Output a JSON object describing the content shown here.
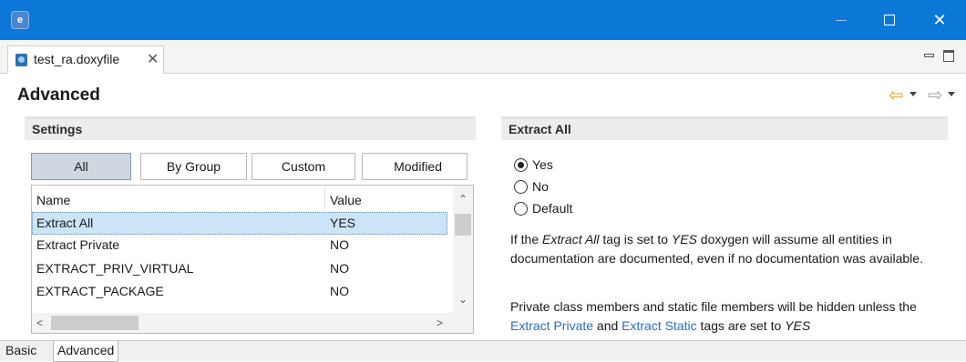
{
  "window": {
    "app_icon_text": "e",
    "minimize_glyph": "—",
    "maximize_glyph": "☐",
    "close_glyph": "✕"
  },
  "editor_tab": {
    "label": "test_ra.doxyfile",
    "close_glyph": "✕"
  },
  "page": {
    "title": "Advanced",
    "back_glyph": "⇦",
    "forward_glyph": "⇨"
  },
  "settings": {
    "header": "Settings",
    "filters": [
      "All",
      "By Group",
      "Custom",
      "Modified"
    ],
    "active_filter": "All",
    "columns": [
      "Name",
      "Value"
    ],
    "rows": [
      {
        "name": "Extract All",
        "value": "YES",
        "selected": true
      },
      {
        "name": "Extract Private",
        "value": "NO",
        "selected": false
      },
      {
        "name": "EXTRACT_PRIV_VIRTUAL",
        "value": "NO",
        "selected": false
      },
      {
        "name": "EXTRACT_PACKAGE",
        "value": "NO",
        "selected": false
      }
    ],
    "scroll_up": "⌃",
    "scroll_down": "⌄",
    "scroll_left": "<",
    "scroll_right": ">"
  },
  "detail": {
    "header": "Extract All",
    "options": [
      "Yes",
      "No",
      "Default"
    ],
    "selected_option": "Yes",
    "para1": {
      "t1": "If the ",
      "em1": "Extract All",
      "t2": " tag is set to ",
      "em2": "YES",
      "t3": " doxygen will assume all entities in documentation are documented, even if no documentation was available."
    },
    "para2": {
      "t1": "Private class members and static file members will be hidden unless the ",
      "link1": "Extract Private",
      "t2": " and ",
      "link2": "Extract Static",
      "t3": " tags are set to ",
      "em1": "YES"
    }
  },
  "bottom_tabs": [
    "Basic",
    "Advanced"
  ],
  "active_bottom_tab": "Advanced",
  "colors": {
    "titlebar": "#0b78d7",
    "selection": "#cce4f7",
    "link": "#2a6fbe",
    "back_arrow": "#f1a21a"
  }
}
